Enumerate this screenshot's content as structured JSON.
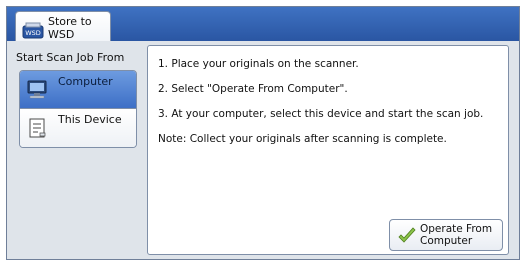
{
  "tab": {
    "label_line1": "Store to",
    "label_line2": "WSD",
    "icon": "wsd-icon",
    "icon_text": "WSD"
  },
  "left": {
    "heading": "Start Scan Job From",
    "options": [
      {
        "label": "Computer",
        "icon": "computer-icon",
        "selected": true
      },
      {
        "label": "This Device",
        "icon": "device-icon",
        "selected": false
      }
    ]
  },
  "instructions": {
    "step1": "1. Place your originals on the scanner.",
    "step2": "2. Select \"Operate From Computer\".",
    "step3": "3. At your computer, select this device and start the scan job.",
    "note": "Note: Collect your originals after scanning is complete."
  },
  "action": {
    "label_line1": "Operate From",
    "label_line2": "Computer",
    "icon": "checkmark-icon"
  },
  "colors": {
    "header": "#2a56a3",
    "selected": "#3d6fc6",
    "check": "#8bc34a"
  }
}
